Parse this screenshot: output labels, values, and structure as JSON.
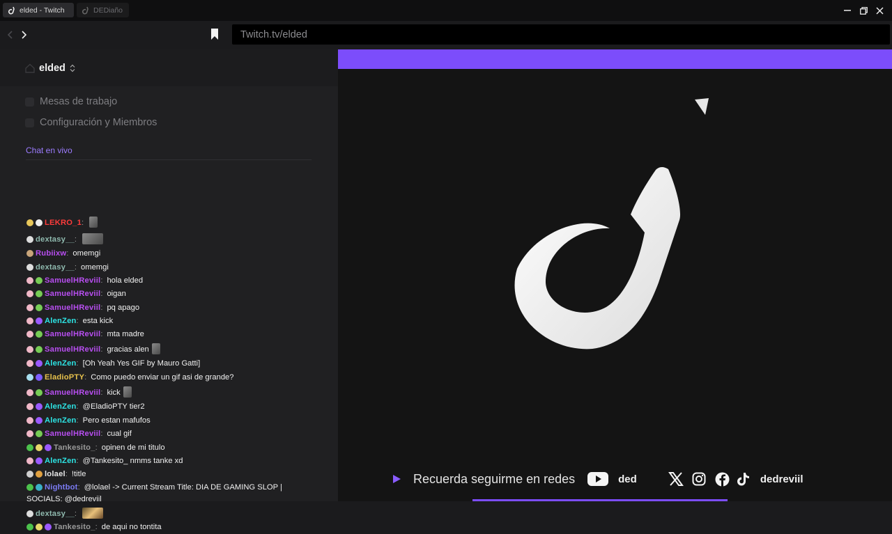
{
  "browser": {
    "tabs": [
      {
        "label": "elded - Twitch",
        "active": true
      },
      {
        "label": "DEDiaño",
        "active": false
      }
    ],
    "url": "Twitch.tv/elded"
  },
  "sidebar": {
    "workspace_name": "elded",
    "menu_items": [
      "Mesas de trabajo",
      "Configuración y Miembros"
    ],
    "chat_label": "Chat en vivo"
  },
  "chat": {
    "messages": [
      {
        "user": "LEKRO_1",
        "color": "#ff3b3b",
        "text": "",
        "emote": true
      },
      {
        "user": "dextasy__",
        "color": "#8fb9ae",
        "text": "",
        "emote": true
      },
      {
        "user": "Rubiixw",
        "color": "#b84ef1",
        "text": "omemgi"
      },
      {
        "user": "dextasy__",
        "color": "#8fb9ae",
        "text": "omemgi"
      },
      {
        "user": "SamuelHReviil",
        "color": "#b84ef1",
        "text": "hola elded"
      },
      {
        "user": "SamuelHReviil",
        "color": "#b84ef1",
        "text": "oigan"
      },
      {
        "user": "SamuelHReviil",
        "color": "#b84ef1",
        "text": "pq apago"
      },
      {
        "user": "AlenZen",
        "color": "#2de4e4",
        "text": "esta kick"
      },
      {
        "user": "SamuelHReviil",
        "color": "#b84ef1",
        "text": "mta madre"
      },
      {
        "user": "SamuelHReviil",
        "color": "#b84ef1",
        "text": "gracias alen",
        "emote": true
      },
      {
        "user": "AlenZen",
        "color": "#2de4e4",
        "text": "[Oh Yeah Yes GIF by Mauro Gatti]"
      },
      {
        "user": "EladioPTY",
        "color": "#e6c14c",
        "text": "Como puedo enviar un gif asi de grande?"
      },
      {
        "user": "SamuelHReviil",
        "color": "#b84ef1",
        "text": "kick",
        "emote": true
      },
      {
        "user": "AlenZen",
        "color": "#2de4e4",
        "text": "@EladioPTY tier2"
      },
      {
        "user": "AlenZen",
        "color": "#2de4e4",
        "text": "Pero estan mafufos"
      },
      {
        "user": "SamuelHReviil",
        "color": "#b84ef1",
        "text": "cual gif"
      },
      {
        "user": "Tankesito_",
        "color": "#9a9a9a",
        "text": "opinen de mi titulo"
      },
      {
        "user": "AlenZen",
        "color": "#2de4e4",
        "text": "@Tankesito_ nmms tanke xd"
      },
      {
        "user": "lolael",
        "color": "#e6e6e6",
        "text": "!title"
      },
      {
        "user": "Nightbot",
        "color": "#7c7cf5",
        "text": "@lolael -> Current Stream Title: DIA DE GAMING SLOP |",
        "text2": "SOCIALS: @dedreviil"
      },
      {
        "user": "dextasy__",
        "color": "#8fb9ae",
        "text": "",
        "emote": true
      },
      {
        "user": "Tankesito_",
        "color": "#9a9a9a",
        "text": "de aqui no tontita"
      }
    ]
  },
  "stream": {
    "footer_text": "Recuerda seguirme en redes",
    "youtube_handle": "ded",
    "socials_handle": "dedreviil",
    "accent": "#7c4dfb"
  }
}
